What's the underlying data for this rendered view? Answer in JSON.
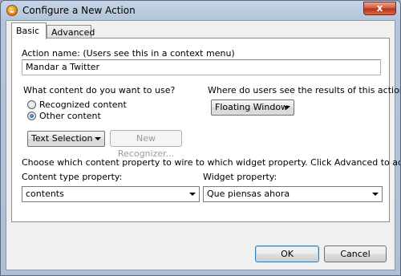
{
  "window": {
    "title": "Configure a New Action",
    "close_glyph": "x"
  },
  "tabs": [
    {
      "label": "Basic"
    },
    {
      "label": "Advanced"
    }
  ],
  "basic": {
    "action_name_label": "Action name: (Users see this in a context menu)",
    "action_name_value": "Mandar a Twitter",
    "content_question": "What content do you want to use?",
    "radio_recognized": "Recognized content",
    "radio_other": "Other content",
    "selected_radio": "Other content",
    "content_combo": "Text Selection",
    "new_recognizer_button": "New Recognizer...",
    "results_question": "Where do users see the results of this action?",
    "results_combo": "Floating Window",
    "wire_instruction": "Choose which content property to wire to which widget property. Click Advanced to add more.",
    "content_type_label": "Content type property:",
    "content_type_value": "contents",
    "widget_property_label": "Widget property:",
    "widget_property_value": "Que piensas ahora"
  },
  "footer": {
    "ok_label": "OK",
    "cancel_label": "Cancel"
  }
}
